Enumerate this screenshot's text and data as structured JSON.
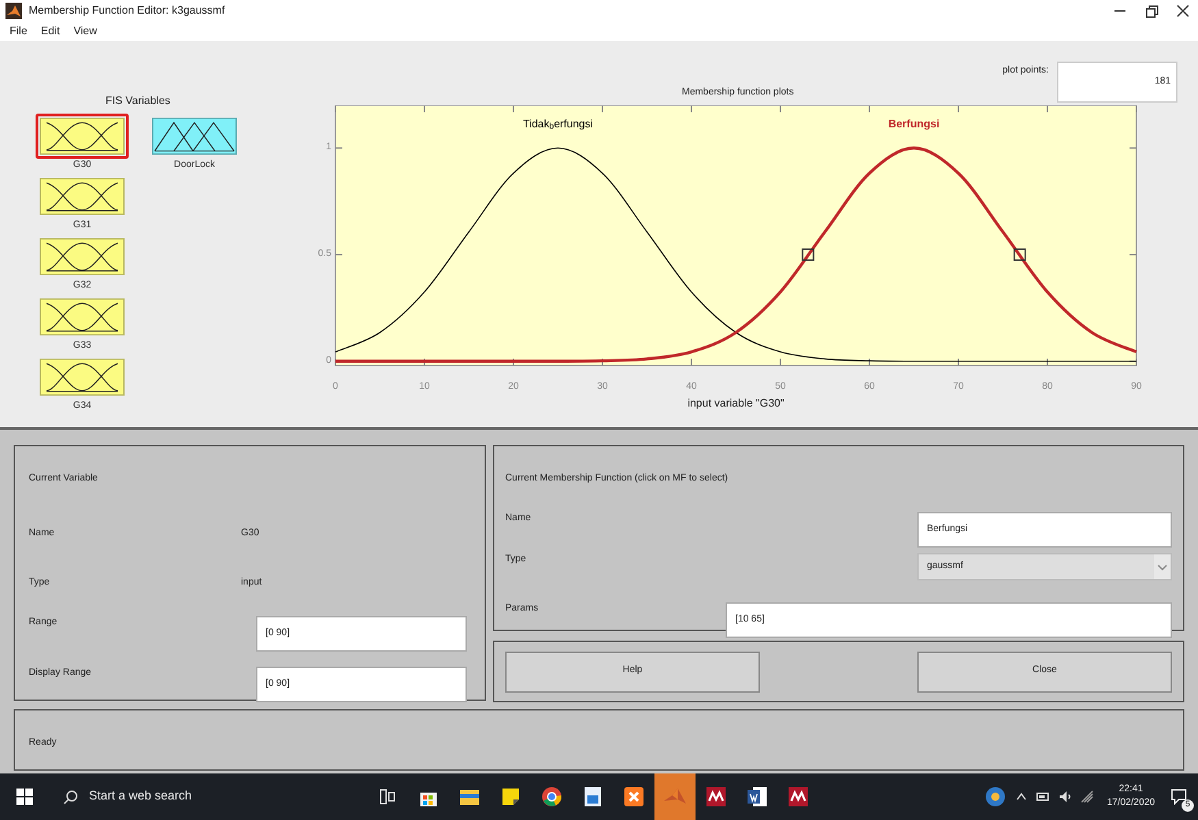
{
  "window": {
    "title": "Membership Function Editor: k3gaussmf"
  },
  "menu": [
    "File",
    "Edit",
    "View"
  ],
  "fis_variables": {
    "title": "FIS Variables",
    "items": [
      {
        "name": "G30",
        "kind": "input",
        "selected": true
      },
      {
        "name": "G31",
        "kind": "input",
        "selected": false
      },
      {
        "name": "G32",
        "kind": "input",
        "selected": false
      },
      {
        "name": "G33",
        "kind": "input",
        "selected": false
      },
      {
        "name": "G34",
        "kind": "input",
        "selected": false
      },
      {
        "name": "DoorLock",
        "kind": "output",
        "selected": false
      }
    ]
  },
  "plot_points": {
    "label": "plot points:",
    "value": "181"
  },
  "plot": {
    "mfs": [
      {
        "selected": false
      },
      {
        "selected": true
      }
    ],
    "chart_data": {
      "type": "line",
      "title": "Membership function plots",
      "xlabel": "input variable \"G30\"",
      "x": [
        0,
        5,
        10,
        15,
        20,
        25,
        30,
        35,
        40,
        45,
        50,
        55,
        60,
        65,
        70,
        75,
        80,
        85,
        90
      ],
      "series": [
        {
          "name": "Tidak$_{b}$erfungsi",
          "color": "#000000",
          "values": [
            0.044,
            0.135,
            0.325,
            0.607,
            0.882,
            1,
            0.882,
            0.607,
            0.325,
            0.135,
            0.044,
            0.011,
            0.002,
            0,
            0,
            0,
            0,
            0,
            0
          ]
        },
        {
          "name": "Berfungsi",
          "color": "#c0282a",
          "values": [
            0,
            0,
            0,
            0,
            0,
            0,
            0.002,
            0.011,
            0.044,
            0.135,
            0.325,
            0.607,
            0.882,
            1,
            0.882,
            0.607,
            0.325,
            0.135,
            0.044
          ]
        }
      ],
      "xlim": [
        0,
        90
      ],
      "ylim": [
        -0.02,
        1.2
      ],
      "xticks": [
        0,
        10,
        20,
        30,
        40,
        50,
        60,
        70,
        80,
        90
      ],
      "yticks": [
        0,
        0.5,
        1
      ]
    }
  },
  "current_variable": {
    "title": "Current Variable",
    "name_label": "Name",
    "name": "G30",
    "type_label": "Type",
    "type": "input",
    "range_label": "Range",
    "range": "[0 90]",
    "display_range_label": "Display Range",
    "display_range": "[0 90]"
  },
  "current_mf": {
    "title": "Current Membership Function (click on MF to select)",
    "name_label": "Name",
    "name": "Berfungsi",
    "type_label": "Type",
    "type": "gaussmf",
    "params_label": "Params",
    "params": "[10 65]"
  },
  "buttons": [
    "Help",
    "Close"
  ],
  "status": "Ready",
  "taskbar": {
    "search_placeholder": "Start a web search",
    "apps": [
      {
        "kind": "taskview",
        "selected": false
      },
      {
        "kind": "store",
        "selected": false
      },
      {
        "kind": "folder",
        "selected": false
      },
      {
        "kind": "notes",
        "selected": false
      },
      {
        "kind": "browser",
        "selected": false
      },
      {
        "kind": "photos",
        "selected": false
      },
      {
        "kind": "server",
        "selected": false
      },
      {
        "kind": "matlab",
        "selected": true
      },
      {
        "kind": "reference",
        "selected": false
      },
      {
        "kind": "word",
        "selected": false
      },
      {
        "kind": "reference",
        "selected": false
      }
    ],
    "time": "22:41",
    "date": "17/02/2020",
    "notifications": "5"
  }
}
